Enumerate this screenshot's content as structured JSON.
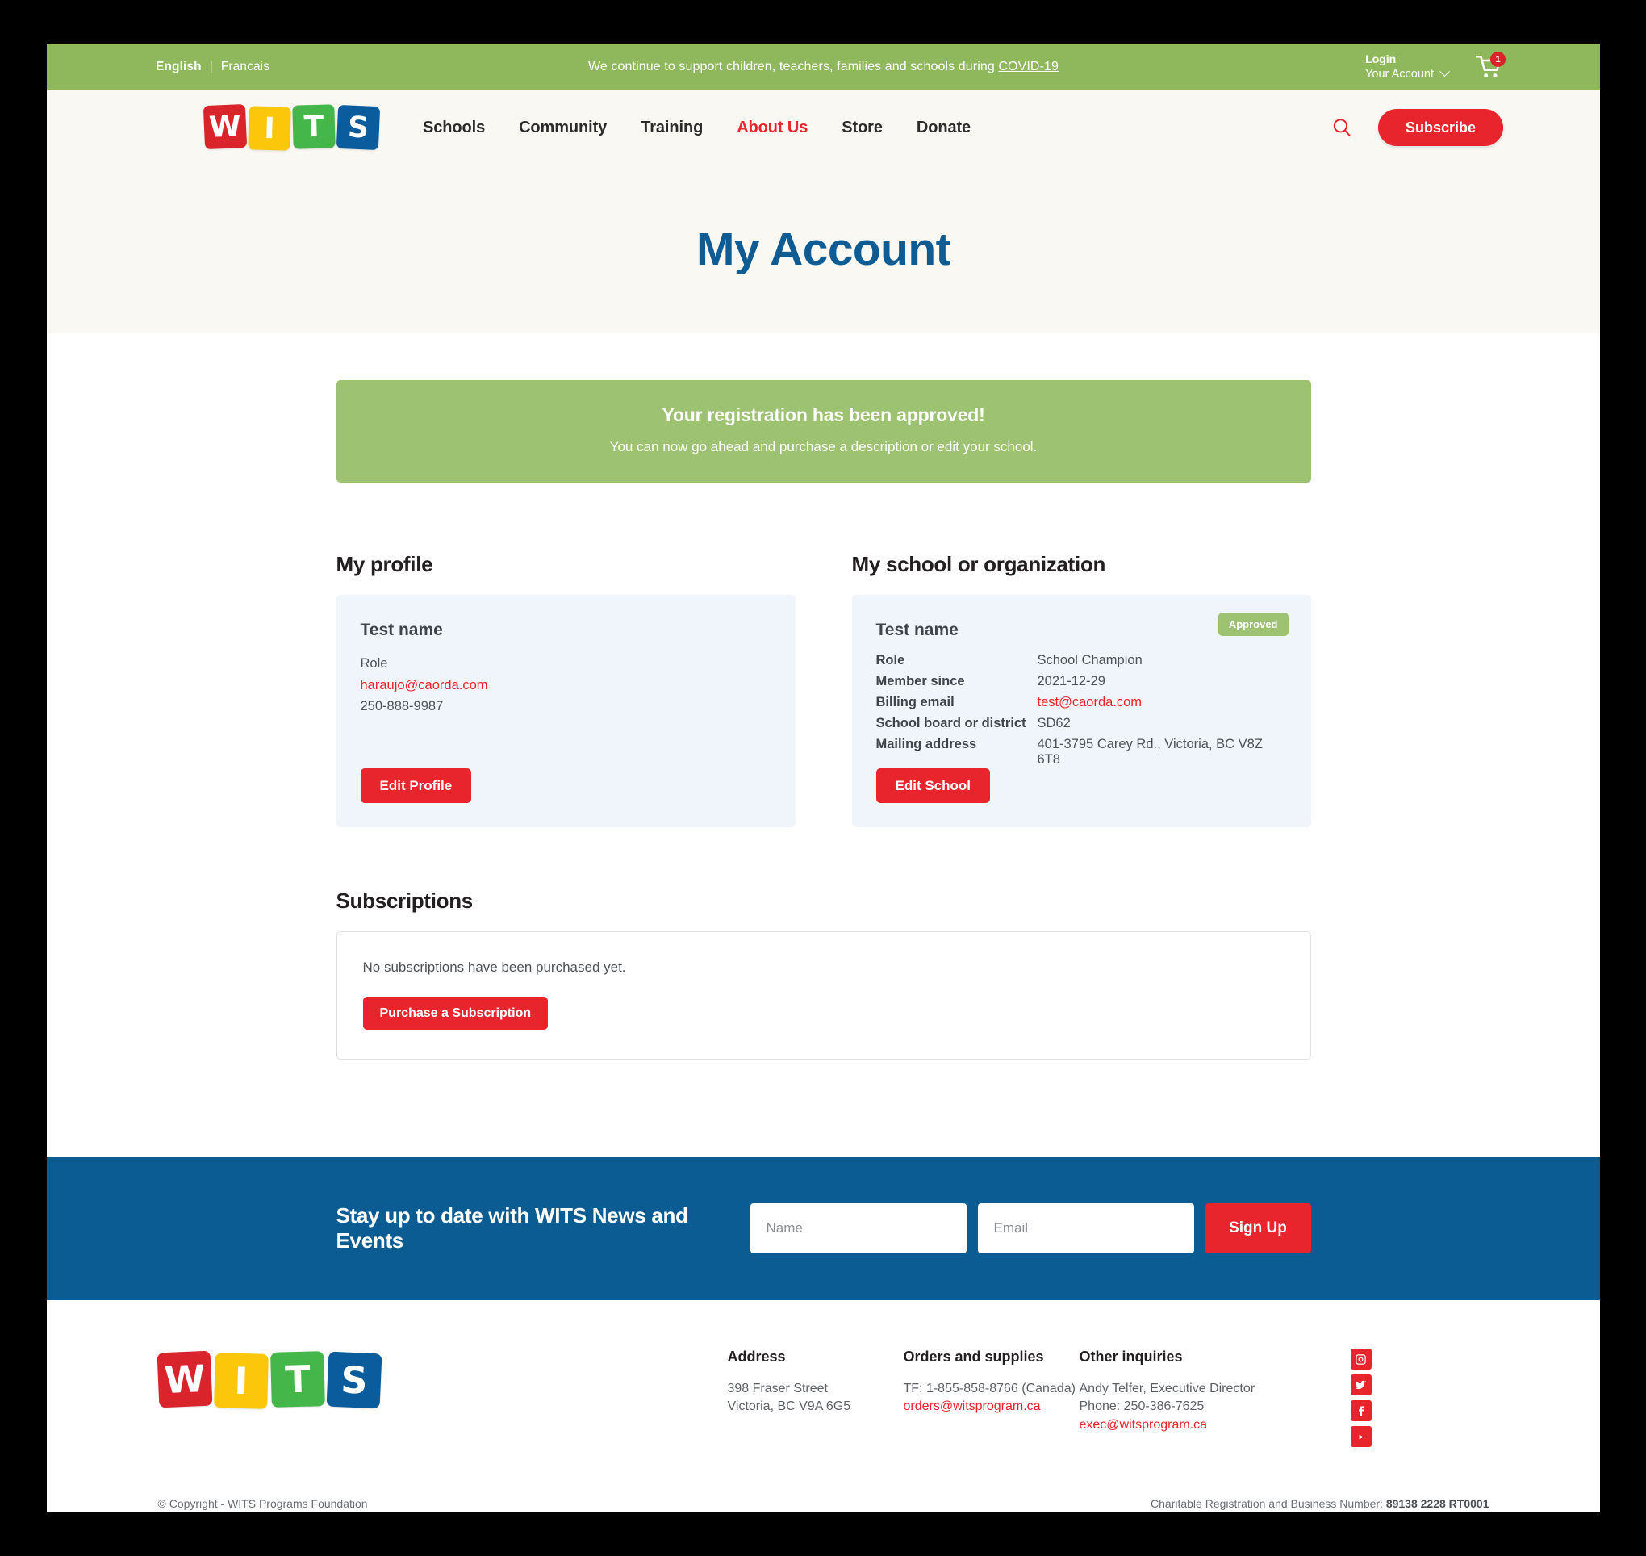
{
  "topbar": {
    "lang_en": "English",
    "lang_sep": "|",
    "lang_fr": "Francais",
    "message_prefix": "We continue to support children, teachers, families and schools during ",
    "message_link": "COVID-19",
    "login_label": "Login",
    "account_label": "Your Account",
    "cart_count": "1",
    "background_color": "#8fb85d"
  },
  "nav": {
    "logo_letters": [
      "W",
      "I",
      "T",
      "S"
    ],
    "logo_colors": [
      "#d9242b",
      "#fcc70b",
      "#45b649",
      "#0a5c9c"
    ],
    "items": [
      {
        "label": "Schools",
        "active": false
      },
      {
        "label": "Community",
        "active": false
      },
      {
        "label": "Training",
        "active": false
      },
      {
        "label": "About Us",
        "active": true
      },
      {
        "label": "Store",
        "active": false
      },
      {
        "label": "Donate",
        "active": false
      }
    ],
    "search_icon": "search-icon",
    "subscribe_label": "Subscribe",
    "accent_color": "#e8242c",
    "active_color": "#e8242c"
  },
  "hero": {
    "title": "My Account",
    "title_color": "#0f5c94"
  },
  "alert": {
    "title": "Your registration has been approved!",
    "subtitle": "You can now go ahead and purchase a description or edit your school.",
    "background_color": "#9dc272"
  },
  "profile": {
    "section_title": "My profile",
    "name": "Test name",
    "role": "Role",
    "email": "haraujo@caorda.com",
    "phone": "250-888-9987",
    "edit_label": "Edit Profile"
  },
  "school": {
    "section_title": "My school or organization",
    "name": "Test name",
    "status_badge": "Approved",
    "fields": [
      {
        "label": "Role",
        "value": "School Champion",
        "is_link": false
      },
      {
        "label": "Member since",
        "value": "2021-12-29",
        "is_link": false
      },
      {
        "label": "Billing email",
        "value": "test@caorda.com",
        "is_link": true
      },
      {
        "label": "School board or district",
        "value": "SD62",
        "is_link": false
      },
      {
        "label": "Mailing address",
        "value": "401-3795 Carey Rd., Victoria, BC V8Z 6T8",
        "is_link": false
      }
    ],
    "edit_label": "Edit School"
  },
  "subscriptions": {
    "section_title": "Subscriptions",
    "empty_message": "No subscriptions have been purchased yet.",
    "purchase_label": "Purchase a Subscription"
  },
  "newsletter": {
    "title": "Stay up to date with WITS News and Events",
    "name_placeholder": "Name",
    "name_value": "",
    "email_placeholder": "Email",
    "email_value": "",
    "signup_label": "Sign Up",
    "background_color": "#0b5c92"
  },
  "footer": {
    "logo_letters": [
      "W",
      "I",
      "T",
      "S"
    ],
    "columns": [
      {
        "heading": "Address",
        "line1": "398 Fraser Street",
        "line2": "Victoria, BC V9A 6G5",
        "line3": ""
      },
      {
        "heading": "Orders and supplies",
        "line1": "TF: 1-855-858-8766 (Canada)",
        "line2": "orders@witsprogram.ca",
        "line3": ""
      },
      {
        "heading": "Other inquiries",
        "line1": "Andy Telfer, Executive Director",
        "line2": "Phone: 250-386-7625",
        "line3": "exec@witsprogram.ca"
      }
    ],
    "social": [
      "instagram-icon",
      "twitter-icon",
      "facebook-icon",
      "youtube-icon"
    ],
    "copyright": "© Copyright - WITS Programs Foundation",
    "charity_label": "Charitable Registration and Business Number: ",
    "charity_number": "89138 2228 RT0001"
  }
}
